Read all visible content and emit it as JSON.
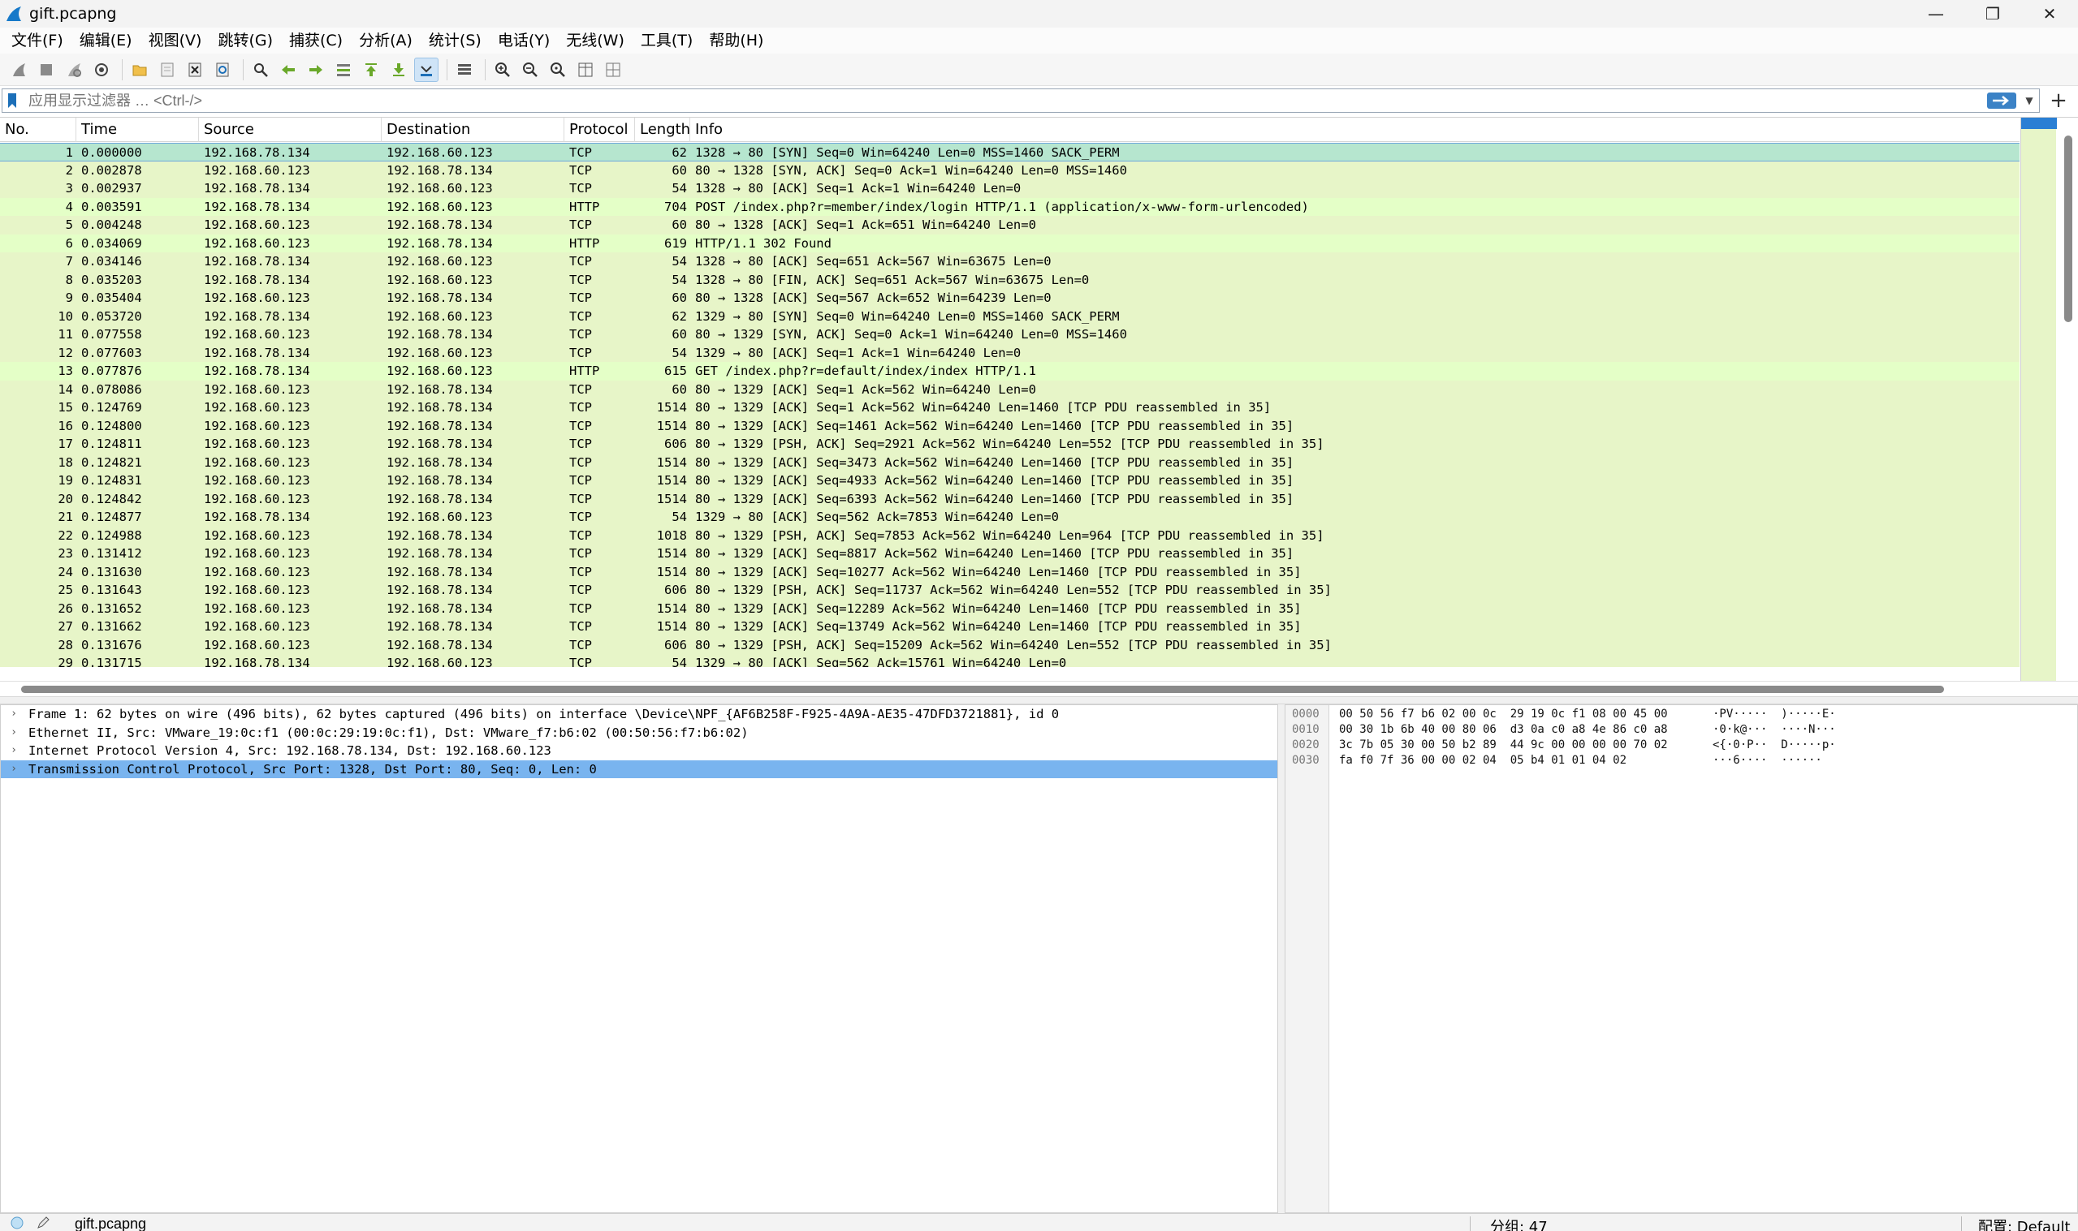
{
  "window": {
    "title": "gift.pcapng",
    "minimize": "—",
    "restore": "❐",
    "close": "✕"
  },
  "menu": [
    "文件(F)",
    "编辑(E)",
    "视图(V)",
    "跳转(G)",
    "捕获(C)",
    "分析(A)",
    "统计(S)",
    "电话(Y)",
    "无线(W)",
    "工具(T)",
    "帮助(H)"
  ],
  "filter": {
    "placeholder": "应用显示过滤器 … <Ctrl-/>",
    "add": "+"
  },
  "columns": {
    "no": "No.",
    "time": "Time",
    "source": "Source",
    "destination": "Destination",
    "protocol": "Protocol",
    "length": "Length",
    "info": "Info"
  },
  "packets": [
    {
      "no": "1",
      "time": "0.000000",
      "src": "192.168.78.134",
      "dst": "192.168.60.123",
      "proto": "TCP",
      "len": "62",
      "info": "1328 → 80 [SYN] Seq=0 Win=64240 Len=0 MSS=1460 SACK_PERM"
    },
    {
      "no": "2",
      "time": "0.002878",
      "src": "192.168.60.123",
      "dst": "192.168.78.134",
      "proto": "TCP",
      "len": "60",
      "info": "80 → 1328 [SYN, ACK] Seq=0 Ack=1 Win=64240 Len=0 MSS=1460"
    },
    {
      "no": "3",
      "time": "0.002937",
      "src": "192.168.78.134",
      "dst": "192.168.60.123",
      "proto": "TCP",
      "len": "54",
      "info": "1328 → 80 [ACK] Seq=1 Ack=1 Win=64240 Len=0"
    },
    {
      "no": "4",
      "time": "0.003591",
      "src": "192.168.78.134",
      "dst": "192.168.60.123",
      "proto": "HTTP",
      "len": "704",
      "info": "POST /index.php?r=member/index/login HTTP/1.1  (application/x-www-form-urlencoded)"
    },
    {
      "no": "5",
      "time": "0.004248",
      "src": "192.168.60.123",
      "dst": "192.168.78.134",
      "proto": "TCP",
      "len": "60",
      "info": "80 → 1328 [ACK] Seq=1 Ack=651 Win=64240 Len=0"
    },
    {
      "no": "6",
      "time": "0.034069",
      "src": "192.168.60.123",
      "dst": "192.168.78.134",
      "proto": "HTTP",
      "len": "619",
      "info": "HTTP/1.1 302 Found"
    },
    {
      "no": "7",
      "time": "0.034146",
      "src": "192.168.78.134",
      "dst": "192.168.60.123",
      "proto": "TCP",
      "len": "54",
      "info": "1328 → 80 [ACK] Seq=651 Ack=567 Win=63675 Len=0"
    },
    {
      "no": "8",
      "time": "0.035203",
      "src": "192.168.78.134",
      "dst": "192.168.60.123",
      "proto": "TCP",
      "len": "54",
      "info": "1328 → 80 [FIN, ACK] Seq=651 Ack=567 Win=63675 Len=0"
    },
    {
      "no": "9",
      "time": "0.035404",
      "src": "192.168.60.123",
      "dst": "192.168.78.134",
      "proto": "TCP",
      "len": "60",
      "info": "80 → 1328 [ACK] Seq=567 Ack=652 Win=64239 Len=0"
    },
    {
      "no": "10",
      "time": "0.053720",
      "src": "192.168.78.134",
      "dst": "192.168.60.123",
      "proto": "TCP",
      "len": "62",
      "info": "1329 → 80 [SYN] Seq=0 Win=64240 Len=0 MSS=1460 SACK_PERM"
    },
    {
      "no": "11",
      "time": "0.077558",
      "src": "192.168.60.123",
      "dst": "192.168.78.134",
      "proto": "TCP",
      "len": "60",
      "info": "80 → 1329 [SYN, ACK] Seq=0 Ack=1 Win=64240 Len=0 MSS=1460"
    },
    {
      "no": "12",
      "time": "0.077603",
      "src": "192.168.78.134",
      "dst": "192.168.60.123",
      "proto": "TCP",
      "len": "54",
      "info": "1329 → 80 [ACK] Seq=1 Ack=1 Win=64240 Len=0"
    },
    {
      "no": "13",
      "time": "0.077876",
      "src": "192.168.78.134",
      "dst": "192.168.60.123",
      "proto": "HTTP",
      "len": "615",
      "info": "GET /index.php?r=default/index/index HTTP/1.1"
    },
    {
      "no": "14",
      "time": "0.078086",
      "src": "192.168.60.123",
      "dst": "192.168.78.134",
      "proto": "TCP",
      "len": "60",
      "info": "80 → 1329 [ACK] Seq=1 Ack=562 Win=64240 Len=0"
    },
    {
      "no": "15",
      "time": "0.124769",
      "src": "192.168.60.123",
      "dst": "192.168.78.134",
      "proto": "TCP",
      "len": "1514",
      "info": "80 → 1329 [ACK] Seq=1 Ack=562 Win=64240 Len=1460 [TCP PDU reassembled in 35]"
    },
    {
      "no": "16",
      "time": "0.124800",
      "src": "192.168.60.123",
      "dst": "192.168.78.134",
      "proto": "TCP",
      "len": "1514",
      "info": "80 → 1329 [ACK] Seq=1461 Ack=562 Win=64240 Len=1460 [TCP PDU reassembled in 35]"
    },
    {
      "no": "17",
      "time": "0.124811",
      "src": "192.168.60.123",
      "dst": "192.168.78.134",
      "proto": "TCP",
      "len": "606",
      "info": "80 → 1329 [PSH, ACK] Seq=2921 Ack=562 Win=64240 Len=552 [TCP PDU reassembled in 35]"
    },
    {
      "no": "18",
      "time": "0.124821",
      "src": "192.168.60.123",
      "dst": "192.168.78.134",
      "proto": "TCP",
      "len": "1514",
      "info": "80 → 1329 [ACK] Seq=3473 Ack=562 Win=64240 Len=1460 [TCP PDU reassembled in 35]"
    },
    {
      "no": "19",
      "time": "0.124831",
      "src": "192.168.60.123",
      "dst": "192.168.78.134",
      "proto": "TCP",
      "len": "1514",
      "info": "80 → 1329 [ACK] Seq=4933 Ack=562 Win=64240 Len=1460 [TCP PDU reassembled in 35]"
    },
    {
      "no": "20",
      "time": "0.124842",
      "src": "192.168.60.123",
      "dst": "192.168.78.134",
      "proto": "TCP",
      "len": "1514",
      "info": "80 → 1329 [ACK] Seq=6393 Ack=562 Win=64240 Len=1460 [TCP PDU reassembled in 35]"
    },
    {
      "no": "21",
      "time": "0.124877",
      "src": "192.168.78.134",
      "dst": "192.168.60.123",
      "proto": "TCP",
      "len": "54",
      "info": "1329 → 80 [ACK] Seq=562 Ack=7853 Win=64240 Len=0"
    },
    {
      "no": "22",
      "time": "0.124988",
      "src": "192.168.60.123",
      "dst": "192.168.78.134",
      "proto": "TCP",
      "len": "1018",
      "info": "80 → 1329 [PSH, ACK] Seq=7853 Ack=562 Win=64240 Len=964 [TCP PDU reassembled in 35]"
    },
    {
      "no": "23",
      "time": "0.131412",
      "src": "192.168.60.123",
      "dst": "192.168.78.134",
      "proto": "TCP",
      "len": "1514",
      "info": "80 → 1329 [ACK] Seq=8817 Ack=562 Win=64240 Len=1460 [TCP PDU reassembled in 35]"
    },
    {
      "no": "24",
      "time": "0.131630",
      "src": "192.168.60.123",
      "dst": "192.168.78.134",
      "proto": "TCP",
      "len": "1514",
      "info": "80 → 1329 [ACK] Seq=10277 Ack=562 Win=64240 Len=1460 [TCP PDU reassembled in 35]"
    },
    {
      "no": "25",
      "time": "0.131643",
      "src": "192.168.60.123",
      "dst": "192.168.78.134",
      "proto": "TCP",
      "len": "606",
      "info": "80 → 1329 [PSH, ACK] Seq=11737 Ack=562 Win=64240 Len=552 [TCP PDU reassembled in 35]"
    },
    {
      "no": "26",
      "time": "0.131652",
      "src": "192.168.60.123",
      "dst": "192.168.78.134",
      "proto": "TCP",
      "len": "1514",
      "info": "80 → 1329 [ACK] Seq=12289 Ack=562 Win=64240 Len=1460 [TCP PDU reassembled in 35]"
    },
    {
      "no": "27",
      "time": "0.131662",
      "src": "192.168.60.123",
      "dst": "192.168.78.134",
      "proto": "TCP",
      "len": "1514",
      "info": "80 → 1329 [ACK] Seq=13749 Ack=562 Win=64240 Len=1460 [TCP PDU reassembled in 35]"
    },
    {
      "no": "28",
      "time": "0.131676",
      "src": "192.168.60.123",
      "dst": "192.168.78.134",
      "proto": "TCP",
      "len": "606",
      "info": "80 → 1329 [PSH, ACK] Seq=15209 Ack=562 Win=64240 Len=552 [TCP PDU reassembled in 35]"
    },
    {
      "no": "29",
      "time": "0.131715",
      "src": "192.168.78.134",
      "dst": "192.168.60.123",
      "proto": "TCP",
      "len": "54",
      "info": "1329 → 80 [ACK] Seq=562 Ack=15761 Win=64240 Len=0"
    }
  ],
  "selected_packet": "1",
  "details": [
    {
      "text": "Frame 1: 62 bytes on wire (496 bits), 62 bytes captured (496 bits) on interface \\Device\\NPF_{AF6B258F-F925-4A9A-AE35-47DFD3721881}, id 0",
      "selected": false
    },
    {
      "text": "Ethernet II, Src: VMware_19:0c:f1 (00:0c:29:19:0c:f1), Dst: VMware_f7:b6:02 (00:50:56:f7:b6:02)",
      "selected": false
    },
    {
      "text": "Internet Protocol Version 4, Src: 192.168.78.134, Dst: 192.168.60.123",
      "selected": false
    },
    {
      "text": "Transmission Control Protocol, Src Port: 1328, Dst Port: 80, Seq: 0, Len: 0",
      "selected": true
    }
  ],
  "bytes": [
    {
      "offset": "0000",
      "hex": "00 50 56 f7 b6 02 00 0c  29 19 0c f1 08 00 45 00",
      "ascii": "·PV·····  )·····E·"
    },
    {
      "offset": "0010",
      "hex": "00 30 1b 6b 40 00 80 06  d3 0a c0 a8 4e 86 c0 a8",
      "ascii": "·0·k@···  ····N···"
    },
    {
      "offset": "0020",
      "hex": "3c 7b 05 30 00 50 b2 89  44 9c 00 00 00 00 70 02",
      "ascii": "<{·0·P··  D·····p·"
    },
    {
      "offset": "0030",
      "hex": "fa f0 7f 36 00 00 02 04  05 b4 01 01 04 02",
      "ascii": "···6····  ······"
    }
  ],
  "status": {
    "file": "gift.pcapng",
    "packets": "分组: 47",
    "profile": "配置: Default"
  },
  "colors": {
    "tcp_row": "#e7f5c8",
    "http_row": "#e4ffc7",
    "selected_row": "#b6e6cf",
    "selected_detail": "#79b4ef"
  }
}
